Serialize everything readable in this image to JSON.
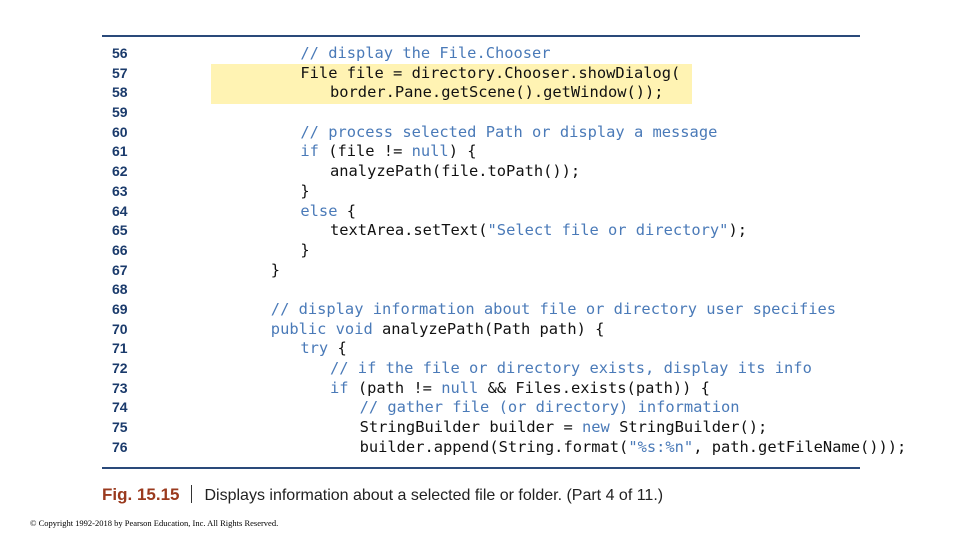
{
  "colors": {
    "line_number": "#1a3a6b",
    "code_text": "#111111",
    "comment_keyword_string": "#4a7ab8",
    "highlight": "#fff3b3",
    "rule": "#2a4a7a",
    "figure_label": "#9a3a1e"
  },
  "code": {
    "lines": [
      {
        "num": "56",
        "indent": 4,
        "highlight": false,
        "tokens": [
          {
            "t": "// display the File.Chooser",
            "c": "comment"
          }
        ]
      },
      {
        "num": "57",
        "indent": 4,
        "highlight": true,
        "tokens": [
          {
            "t": "File file = directory.Chooser.showDialog(",
            "c": ""
          }
        ]
      },
      {
        "num": "58",
        "indent": 5,
        "highlight": true,
        "tokens": [
          {
            "t": "border.Pane.getScene().getWindow());",
            "c": ""
          }
        ]
      },
      {
        "num": "59",
        "indent": 0,
        "highlight": false,
        "tokens": []
      },
      {
        "num": "60",
        "indent": 4,
        "highlight": false,
        "tokens": [
          {
            "t": "// process selected Path or display a message",
            "c": "comment"
          }
        ]
      },
      {
        "num": "61",
        "indent": 4,
        "highlight": false,
        "tokens": [
          {
            "t": "if",
            "c": "keyword"
          },
          {
            "t": " (file != ",
            "c": ""
          },
          {
            "t": "null",
            "c": "keyword"
          },
          {
            "t": ") {",
            "c": ""
          }
        ]
      },
      {
        "num": "62",
        "indent": 5,
        "highlight": false,
        "tokens": [
          {
            "t": "analyzePath(file.toPath());",
            "c": ""
          }
        ]
      },
      {
        "num": "63",
        "indent": 4,
        "highlight": false,
        "tokens": [
          {
            "t": "}",
            "c": ""
          }
        ]
      },
      {
        "num": "64",
        "indent": 4,
        "highlight": false,
        "tokens": [
          {
            "t": "else",
            "c": "keyword"
          },
          {
            "t": " {",
            "c": ""
          }
        ]
      },
      {
        "num": "65",
        "indent": 5,
        "highlight": false,
        "tokens": [
          {
            "t": "textArea.setText(",
            "c": ""
          },
          {
            "t": "\"Select file or directory\"",
            "c": "string"
          },
          {
            "t": ");",
            "c": ""
          }
        ]
      },
      {
        "num": "66",
        "indent": 4,
        "highlight": false,
        "tokens": [
          {
            "t": "}",
            "c": ""
          }
        ]
      },
      {
        "num": "67",
        "indent": 3,
        "highlight": false,
        "tokens": [
          {
            "t": "}",
            "c": ""
          }
        ]
      },
      {
        "num": "68",
        "indent": 0,
        "highlight": false,
        "tokens": []
      },
      {
        "num": "69",
        "indent": 3,
        "highlight": false,
        "tokens": [
          {
            "t": "// display information about file or directory user specifies",
            "c": "comment"
          }
        ]
      },
      {
        "num": "70",
        "indent": 3,
        "highlight": false,
        "tokens": [
          {
            "t": "public void",
            "c": "keyword"
          },
          {
            "t": " analyzePath(Path path) {",
            "c": ""
          }
        ]
      },
      {
        "num": "71",
        "indent": 4,
        "highlight": false,
        "tokens": [
          {
            "t": "try",
            "c": "keyword"
          },
          {
            "t": " {",
            "c": ""
          }
        ]
      },
      {
        "num": "72",
        "indent": 5,
        "highlight": false,
        "tokens": [
          {
            "t": "// if the file or directory exists, display its info",
            "c": "comment"
          }
        ]
      },
      {
        "num": "73",
        "indent": 5,
        "highlight": false,
        "tokens": [
          {
            "t": "if",
            "c": "keyword"
          },
          {
            "t": " (path != ",
            "c": ""
          },
          {
            "t": "null",
            "c": "keyword"
          },
          {
            "t": " && Files.exists(path)) {",
            "c": ""
          }
        ]
      },
      {
        "num": "74",
        "indent": 6,
        "highlight": false,
        "tokens": [
          {
            "t": "// gather file (or directory) information",
            "c": "comment"
          }
        ]
      },
      {
        "num": "75",
        "indent": 6,
        "highlight": false,
        "tokens": [
          {
            "t": "StringBuilder builder = ",
            "c": ""
          },
          {
            "t": "new",
            "c": "keyword"
          },
          {
            "t": " StringBuilder();",
            "c": ""
          }
        ]
      },
      {
        "num": "76",
        "indent": 6,
        "highlight": false,
        "tokens": [
          {
            "t": "builder.append(String.format(",
            "c": ""
          },
          {
            "t": "\"%s:%n\"",
            "c": "string"
          },
          {
            "t": ", path.getFileName()));",
            "c": ""
          }
        ]
      }
    ]
  },
  "caption": {
    "label": "Fig. 15.15",
    "text": "Displays information about a selected file or folder. (Part 4 of 11.)"
  },
  "copyright": "© Copyright 1992-2018 by Pearson Education, Inc. All Rights Reserved."
}
